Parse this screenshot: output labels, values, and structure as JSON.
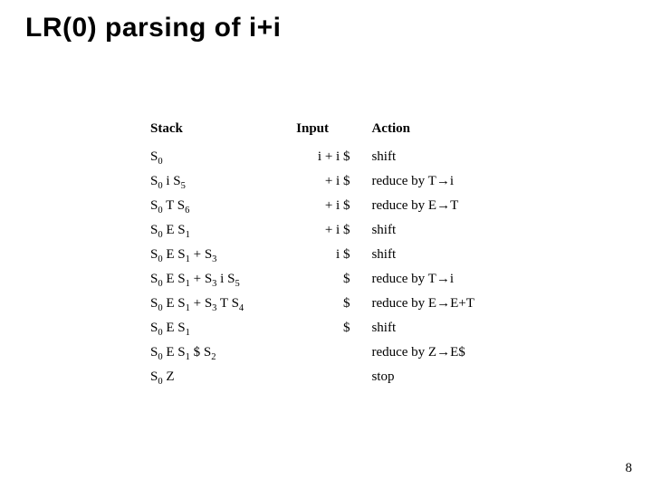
{
  "title": "LR(0) parsing of i+i",
  "headers": {
    "stack": "Stack",
    "input": "Input",
    "action": "Action"
  },
  "rows": [
    {
      "stack_tokens": [
        "S0"
      ],
      "input": "i + i $",
      "action_kind": "plain",
      "action_text": "shift"
    },
    {
      "stack_tokens": [
        "S0",
        "i",
        "S5"
      ],
      "input": "+ i $",
      "action_kind": "reduce",
      "action_lhs": "T",
      "action_rhs": "i"
    },
    {
      "stack_tokens": [
        "S0",
        "T",
        "S6"
      ],
      "input": "+ i $",
      "action_kind": "reduce",
      "action_lhs": "E",
      "action_rhs": "T"
    },
    {
      "stack_tokens": [
        "S0",
        "E",
        "S1"
      ],
      "input": "+ i $",
      "action_kind": "plain",
      "action_text": "shift"
    },
    {
      "stack_tokens": [
        "S0",
        "E",
        "S1",
        "+",
        "S3"
      ],
      "input": "i $",
      "action_kind": "plain",
      "action_text": "shift"
    },
    {
      "stack_tokens": [
        "S0",
        "E",
        "S1",
        "+",
        "S3",
        "i",
        "S5"
      ],
      "input": "$",
      "action_kind": "reduce",
      "action_lhs": "T",
      "action_rhs": "i"
    },
    {
      "stack_tokens": [
        "S0",
        "E",
        "S1",
        "+",
        "S3",
        "T",
        "S4"
      ],
      "input": "$",
      "action_kind": "reduce",
      "action_lhs": "E",
      "action_rhs": "E+T"
    },
    {
      "stack_tokens": [
        "S0",
        "E",
        "S1"
      ],
      "input": "$",
      "action_kind": "plain",
      "action_text": "shift"
    },
    {
      "stack_tokens": [
        "S0",
        "E",
        "S1",
        "$",
        "S2"
      ],
      "input": "",
      "action_kind": "reduce",
      "action_lhs": "Z",
      "action_rhs": "E$"
    },
    {
      "stack_tokens": [
        "S0",
        "Z"
      ],
      "input": "",
      "action_kind": "plain",
      "action_text": "stop"
    }
  ],
  "reduce_prefix": "reduce by ",
  "arrow_glyph": "→",
  "page_number": "8"
}
